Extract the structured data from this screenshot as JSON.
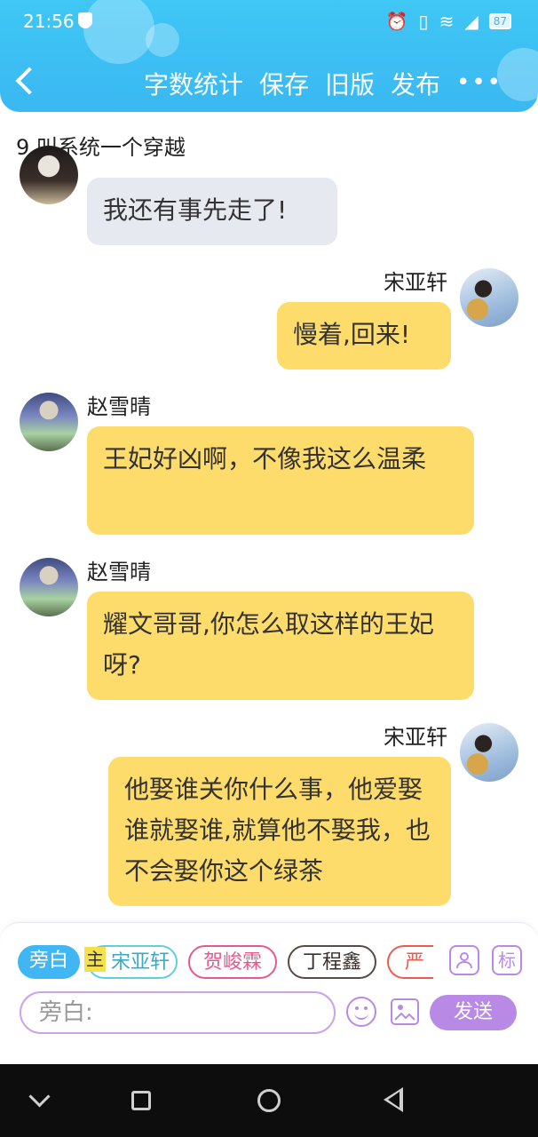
{
  "status_bar": {
    "time": "21:56",
    "battery": "87"
  },
  "header": {
    "actions": [
      "字数统计",
      "保存",
      "旧版",
      "发布"
    ],
    "more": "•••"
  },
  "chapter_title": "9.叫系统一个穿越",
  "messages": [
    {
      "speaker": "",
      "text": "我还有事先走了!"
    },
    {
      "speaker": "宋亚轩",
      "text": "慢着,回来!"
    },
    {
      "speaker": "赵雪晴",
      "text": "王妃好凶啊，不像我这么温柔"
    },
    {
      "speaker": "赵雪晴",
      "text": "耀文哥哥,你怎么取这样的王妃呀?"
    },
    {
      "speaker": "宋亚轩",
      "text": "他娶谁关你什么事，他爱娶谁就娶谁,就算他不娶我，也不会娶你这个绿茶"
    }
  ],
  "roles": {
    "narration": "旁白",
    "main_tag": "主",
    "items": [
      "宋亚轩",
      "贺峻霖",
      "丁程鑫",
      "严浩"
    ]
  },
  "tool_icons": {
    "person": "person-icon",
    "mark": "标"
  },
  "input": {
    "placeholder": "旁白:"
  },
  "send_label": "发送"
}
